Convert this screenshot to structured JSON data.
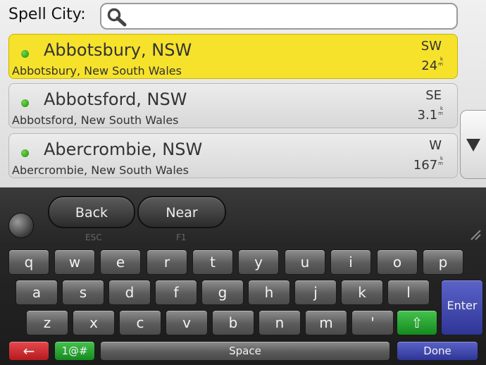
{
  "search": {
    "label": "Spell City:",
    "value": "",
    "placeholder": ""
  },
  "results": [
    {
      "name": "Abbotsbury, NSW",
      "full": "Abbotsbury, New South Wales",
      "direction": "SW",
      "distance": "24",
      "unit_top": "k",
      "unit_bottom": "m"
    },
    {
      "name": "Abbotsford, NSW",
      "full": "Abbotsford, New South Wales",
      "direction": "SE",
      "distance": "3.1",
      "unit_top": "k",
      "unit_bottom": "m"
    },
    {
      "name": "Abercrombie, NSW",
      "full": "Abercrombie, New South Wales",
      "direction": "W",
      "distance": "167",
      "unit_top": "k",
      "unit_bottom": "m"
    }
  ],
  "softkeys": {
    "back": "Back",
    "back_hint": "ESC",
    "near": "Near",
    "near_hint": "F1"
  },
  "keyboard": {
    "row1": [
      "q",
      "w",
      "e",
      "r",
      "t",
      "y",
      "u",
      "i",
      "o",
      "p"
    ],
    "row2": [
      "a",
      "s",
      "d",
      "f",
      "g",
      "h",
      "j",
      "k",
      "l"
    ],
    "row3": [
      "z",
      "x",
      "c",
      "v",
      "b",
      "n",
      "m",
      "'"
    ],
    "shift": "⇧",
    "enter": "Enter",
    "backspace": "←",
    "symbols": "1@#",
    "space": "Space",
    "done": "Done"
  },
  "colors": {
    "selected": "#f6e22b",
    "status_dot": "#2aa51a",
    "enter": "#3a42b0",
    "backspace": "#c8262a",
    "shift": "#1e9a27"
  },
  "icons": {
    "search": "search-icon",
    "scroll": "scroll-down-arrow-icon",
    "trackball": "trackball-icon",
    "resize": "resize-grip-icon"
  }
}
